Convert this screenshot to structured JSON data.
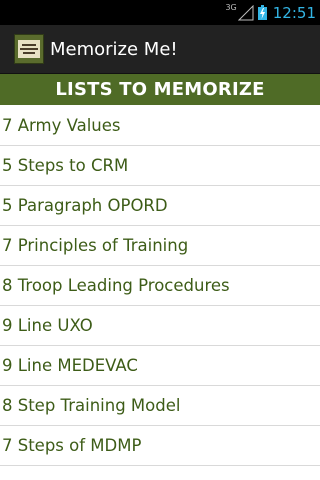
{
  "status_bar": {
    "network": "3G",
    "time": "12:51"
  },
  "action_bar": {
    "title": "Memorize Me!",
    "icon": "army-infantry-guide-book-icon"
  },
  "header": {
    "title": "LISTS TO MEMORIZE"
  },
  "list": {
    "items": [
      {
        "label": "7 Army Values"
      },
      {
        "label": "5 Steps to CRM"
      },
      {
        "label": "5 Paragraph OPORD"
      },
      {
        "label": "7 Principles of Training"
      },
      {
        "label": "8 Troop Leading Procedures"
      },
      {
        "label": "9 Line UXO"
      },
      {
        "label": "9 Line MEDEVAC"
      },
      {
        "label": "8 Step Training Model"
      },
      {
        "label": "7 Steps of MDMP"
      }
    ]
  },
  "colors": {
    "header_background": "#4f6b26",
    "list_text": "#3d5c17",
    "status_accent": "#33b5e5",
    "action_bar": "#222222"
  }
}
